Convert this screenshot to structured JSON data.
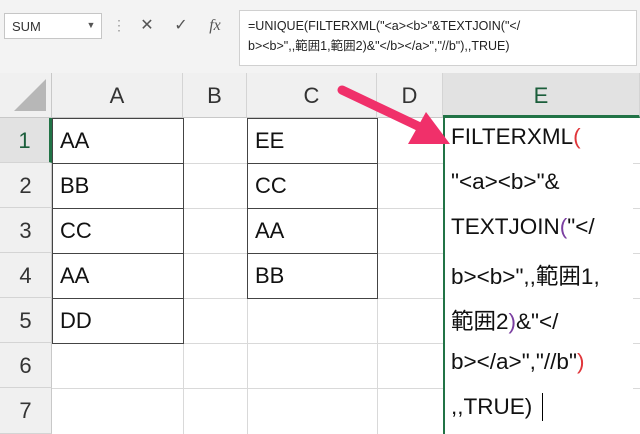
{
  "name_box": {
    "value": "SUM"
  },
  "formula_bar": {
    "cancel_glyph": "✕",
    "enter_glyph": "✓",
    "fx_glyph": "fx",
    "line1": "=UNIQUE(FILTERXML(\"<a><b>\"&TEXTJOIN(\"</",
    "line2": "b><b>\",,範囲1,範囲2)&\"</b></a>\",\"//b\"),,TRUE)"
  },
  "columns": [
    "A",
    "B",
    "C",
    "D",
    "E"
  ],
  "rows": [
    "1",
    "2",
    "3",
    "4",
    "5",
    "6",
    "7"
  ],
  "column_a": [
    "AA",
    "BB",
    "CC",
    "AA",
    "DD"
  ],
  "column_c": [
    "EE",
    "CC",
    "AA",
    "BB"
  ],
  "edit_cell": {
    "line1": "FILTERXML",
    "line1_paren": "(",
    "line2": "\"<a><b>\"&",
    "line3a": "TEXTJOIN",
    "line3b": "(",
    "line3c": "\"</",
    "line4": "b><b>\",,範囲1,",
    "line5a": "範囲2",
    "line5b": ")",
    "line5c": "&\"</",
    "line6a": "b></a>\",\"//b\"",
    "line6b": ")",
    "line7": ",,TRUE)"
  },
  "colors": {
    "accent": "#217346",
    "arrow": "#f0306a",
    "paren_red": "#e0363b",
    "paren_purple": "#7b3fa1"
  }
}
